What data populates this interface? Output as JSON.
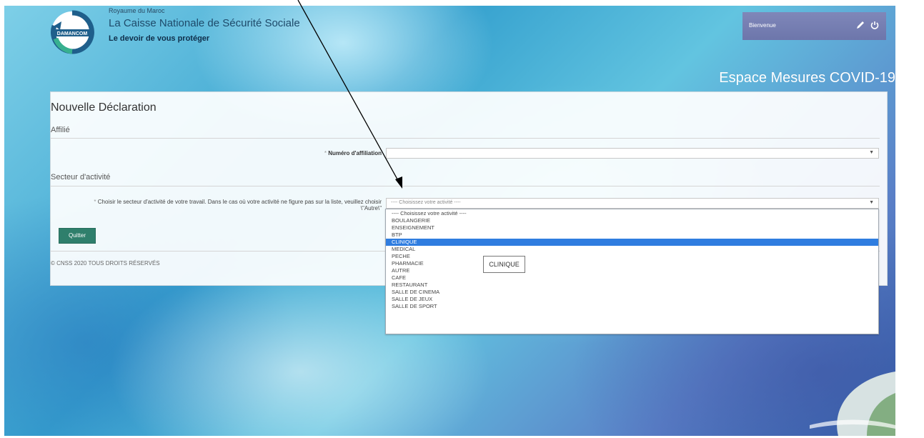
{
  "header": {
    "logo_text": "DAMANCOM",
    "small_title": "Royaume du Maroc",
    "title": "La Caisse Nationale de Sécurité Sociale",
    "tagline": "Le devoir de vous protéger",
    "welcome_label": "Bienvenue",
    "space_title": "Espace Mesures COVID-19"
  },
  "form": {
    "title": "Nouvelle Déclaration",
    "section_affilie": "Affilié",
    "affiliation_label": "Numéro d'affiliation",
    "affiliation_value": "",
    "section_secteur": "Secteur d'activité",
    "secteur_label_line1": "Choisir le secteur d'activité de votre travail. Dans le cas où votre activité ne figure pas sur la liste, veuillez choisir",
    "secteur_label_line2": "\\\"Autre\\\"",
    "secteur_selected": "---- Choisissez votre activité ----",
    "quit_button": "Quitter",
    "copyright": "© CNSS 2020 TOUS DROITS RÉSERVÉS"
  },
  "dropdown": {
    "options": [
      "---- Choisissez votre activité ----",
      "BOULANGERIE",
      "ENSEIGNEMENT",
      "BTP",
      "CLINIQUE",
      "MEDICAL",
      "PECHE",
      "PHARMACIE",
      "AUTRE",
      "CAFE",
      "RESTAURANT",
      "SALLE DE CINEMA",
      "SALLE DE JEUX",
      "SALLE DE SPORT"
    ],
    "highlighted": "CLINIQUE",
    "tooltip": "CLINIQUE"
  },
  "icons": {
    "edit": "pencil-icon",
    "power": "power-icon",
    "caret": "▼"
  },
  "colors": {
    "quit_button": "#2f7f6c",
    "highlight": "#2f7de0",
    "welcome_bg": "#7f87b9"
  }
}
